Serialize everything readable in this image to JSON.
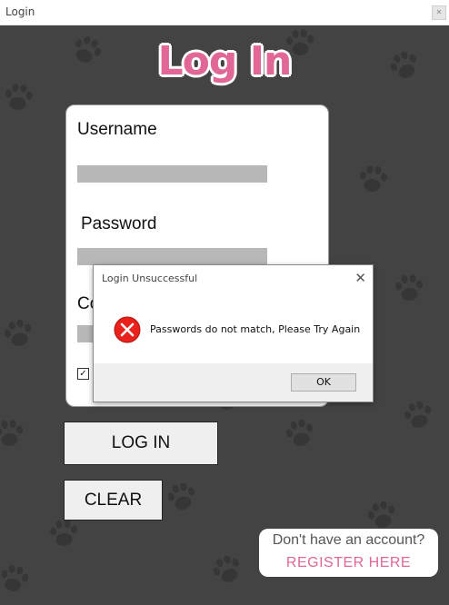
{
  "window": {
    "title": "Login"
  },
  "heading": "Log In",
  "form": {
    "username_label": "Username",
    "password_label": "Password",
    "confirm_label_visible": "Co"
  },
  "buttons": {
    "login": "LOG IN",
    "clear": "CLEAR"
  },
  "register": {
    "prompt": "Don't have an account?",
    "link": "REGISTER HERE"
  },
  "dialog": {
    "title": "Login Unsuccessful",
    "message": "Passwords do not match, Please Try Again",
    "ok": "OK",
    "icon": "error-icon"
  },
  "colors": {
    "background": "#434343",
    "accent": "#e06796",
    "paw": "#363636"
  }
}
